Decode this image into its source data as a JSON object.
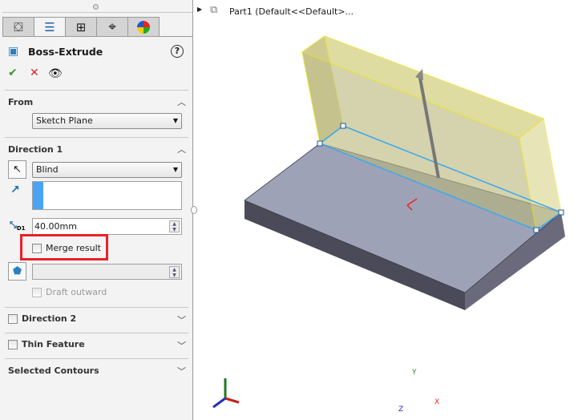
{
  "panel": {
    "tabs": [
      {
        "icon": "feature-manager-icon"
      },
      {
        "icon": "property-manager-icon"
      },
      {
        "icon": "configuration-manager-icon"
      },
      {
        "icon": "dimxpert-icon"
      },
      {
        "icon": "display-manager-icon"
      }
    ],
    "title": "Boss-Extrude",
    "from": {
      "label": "From",
      "value": "Sketch Plane"
    },
    "direction1": {
      "label": "Direction 1",
      "end_condition": "Blind",
      "depth": "40.00mm",
      "merge_result": "Merge result",
      "merge_checked": false,
      "draft_outward": "Draft outward"
    },
    "direction2": {
      "label": "Direction 2"
    },
    "thin_feature": {
      "label": "Thin Feature"
    },
    "selected_contours": {
      "label": "Selected Contours"
    }
  },
  "viewport": {
    "tree_label": "Part1  (Default<<Default>...",
    "axes": {
      "x": "X",
      "y": "Y",
      "z": "Z"
    }
  },
  "colors": {
    "highlight": "#e8212a",
    "preview": "#f5f08c",
    "edge": "#3aa8f0"
  }
}
